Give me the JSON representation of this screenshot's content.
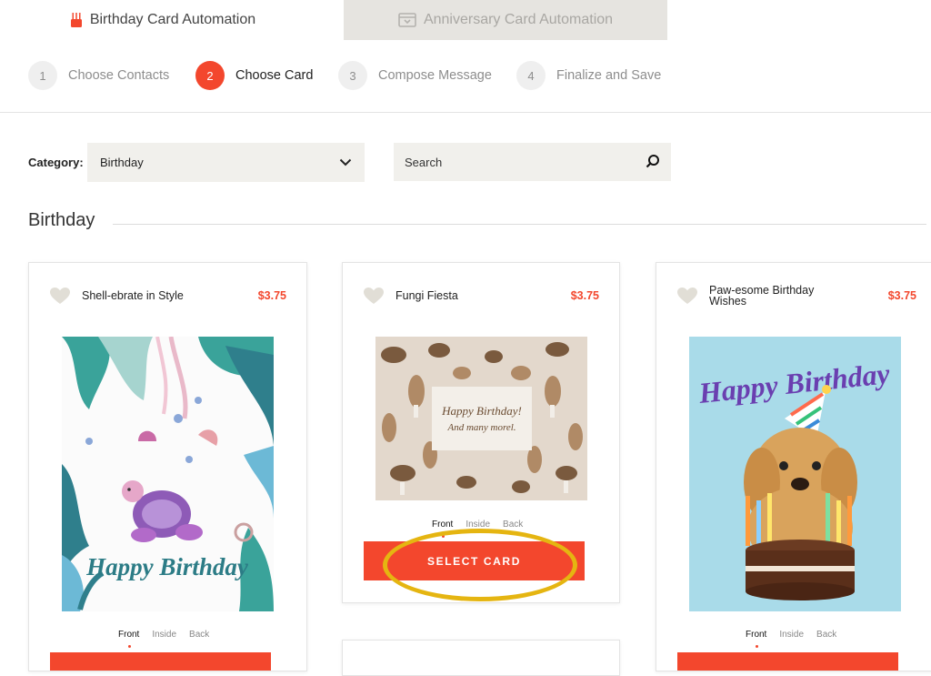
{
  "tabs": [
    {
      "label": "Birthday Card Automation",
      "icon": "birthday-cake-icon",
      "active": true
    },
    {
      "label": "Anniversary Card Automation",
      "icon": "card-box-icon",
      "active": false
    }
  ],
  "steps": [
    {
      "num": "1",
      "label": "Choose Contacts",
      "active": false
    },
    {
      "num": "2",
      "label": "Choose Card",
      "active": true
    },
    {
      "num": "3",
      "label": "Compose Message",
      "active": false
    },
    {
      "num": "4",
      "label": "Finalize and Save",
      "active": false
    }
  ],
  "filters": {
    "category_label": "Category:",
    "category_value": "Birthday",
    "search_placeholder": "Search"
  },
  "section": {
    "title": "Birthday"
  },
  "cards": [
    {
      "title": "Shell-ebrate in Style",
      "price": "$3.75",
      "views": [
        "Front",
        "Inside",
        "Back"
      ],
      "image": {
        "title": "Happy Birthday"
      }
    },
    {
      "title": "Fungi Fiesta",
      "price": "$3.75",
      "views": [
        "Front",
        "Inside",
        "Back"
      ],
      "select_label": "SELECT CARD",
      "image": {
        "line1": "Happy Birthday!",
        "line2": "And many morel."
      }
    },
    {
      "title": "Paw-esome Birthday Wishes",
      "price": "$3.75",
      "views": [
        "Front",
        "Inside",
        "Back"
      ],
      "image": {
        "title": "Happy Birthday"
      }
    }
  ],
  "colors": {
    "accent": "#f3472d",
    "highlight": "#e5b511",
    "field_bg": "#f1f0ec",
    "inactive_tab": "#e6e4e0"
  }
}
